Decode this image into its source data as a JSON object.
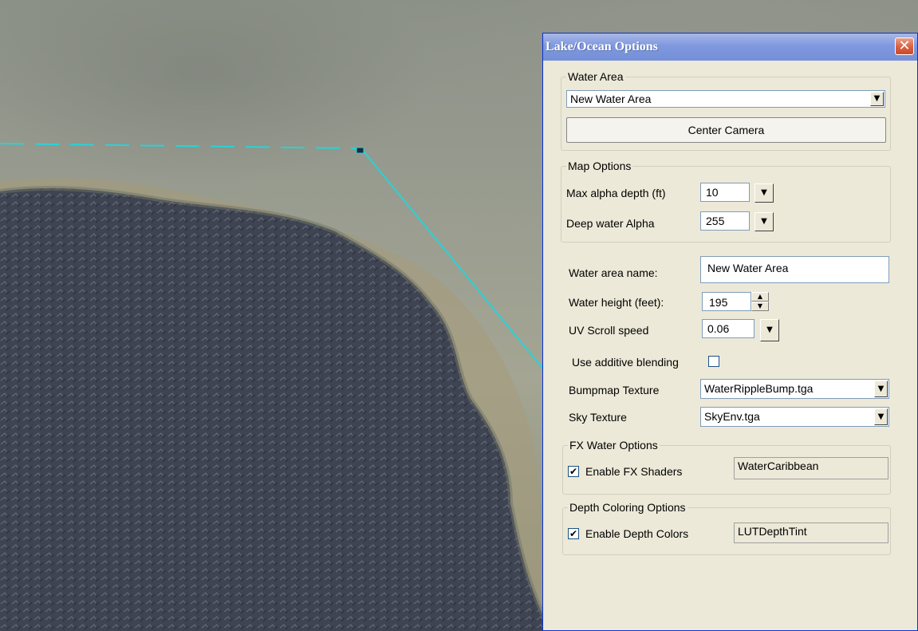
{
  "window": {
    "title": "Lake/Ocean Options",
    "close_glyph": "✕"
  },
  "water_area": {
    "group_label": "Water Area",
    "selected": "New Water Area",
    "center_camera_label": "Center Camera"
  },
  "map_options": {
    "group_label": "Map Options",
    "max_alpha_label": "Max alpha depth (ft)",
    "max_alpha_value": "10",
    "deep_alpha_label": "Deep water Alpha",
    "deep_alpha_value": "255"
  },
  "properties": {
    "name_label": "Water area name:",
    "name_value": "New Water Area",
    "height_label": "Water height (feet):",
    "height_value": "195",
    "uv_label": "UV Scroll speed",
    "uv_value": "0.06",
    "additive_label": "Use additive blending",
    "additive_checked": false,
    "bumpmap_label": "Bumpmap Texture",
    "bumpmap_value": "WaterRippleBump.tga",
    "sky_label": "Sky Texture",
    "sky_value": "SkyEnv.tga"
  },
  "fx_water": {
    "group_label": "FX Water Options",
    "enable_label": "Enable FX Shaders",
    "enabled": true,
    "shader_value": "WaterCaribbean"
  },
  "depth_coloring": {
    "group_label": "Depth Coloring Options",
    "enable_label": "Enable Depth Colors",
    "enabled": true,
    "lut_value": "LUTDepthTint"
  },
  "glyphs": {
    "check": "✔",
    "dropdown": "▼",
    "spin_up": "▲",
    "spin_down": "▼"
  },
  "colors": {
    "title_bar": "#7f98de",
    "dialog_bg": "#ece9d8",
    "selection_line": "#27d3d8",
    "water": "#3d4250"
  }
}
